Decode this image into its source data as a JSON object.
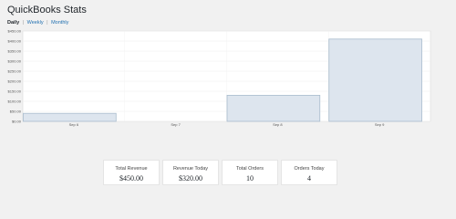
{
  "page": {
    "title": "QuickBooks Stats"
  },
  "tabs": [
    {
      "label": "Daily",
      "active": true
    },
    {
      "label": "Weekly",
      "active": false
    },
    {
      "label": "Monthly",
      "active": false
    }
  ],
  "tab_separator": "|",
  "chart_data": {
    "type": "bar",
    "categories": [
      "Sep 6",
      "Sep 7",
      "Sep 8",
      "Sep 9"
    ],
    "values": [
      40,
      0,
      130,
      410
    ],
    "ylim": [
      0,
      450
    ],
    "yticks": [
      0,
      50,
      100,
      150,
      200,
      250,
      300,
      350,
      400,
      450
    ],
    "ytick_labels": [
      "$0.00",
      "$50.00",
      "$100.00",
      "$150.00",
      "$200.00",
      "$250.00",
      "$300.00",
      "$350.00",
      "$400.00",
      "$450.00"
    ],
    "bar_fill": "#dde5ee",
    "bar_stroke": "#a9bccd",
    "grid": true
  },
  "stats": [
    {
      "label": "Total Revenue",
      "value": "$450.00"
    },
    {
      "label": "Revenue Today",
      "value": "$320.00"
    },
    {
      "label": "Total Orders",
      "value": "10"
    },
    {
      "label": "Orders Today",
      "value": "4"
    }
  ]
}
